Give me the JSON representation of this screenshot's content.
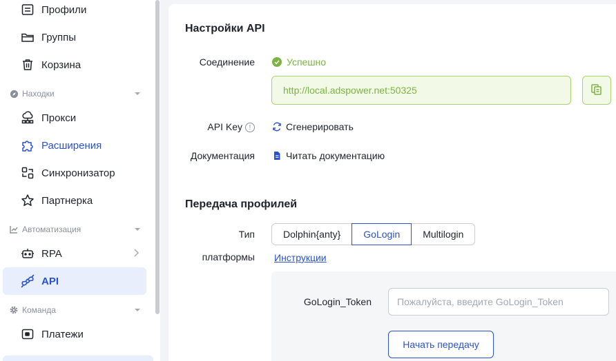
{
  "sidebar": {
    "items": [
      {
        "label": "Профили",
        "icon": "profiles-icon"
      },
      {
        "label": "Группы",
        "icon": "folder-icon"
      },
      {
        "label": "Корзина",
        "icon": "trash-icon"
      },
      {
        "label": "Прокси",
        "icon": "proxy-icon"
      },
      {
        "label": "Расширения",
        "icon": "puzzle-icon"
      },
      {
        "label": "Синхронизатор",
        "icon": "sync-icon"
      },
      {
        "label": "Партнерка",
        "icon": "star-icon"
      },
      {
        "label": "RPA",
        "icon": "robot-icon"
      },
      {
        "label": "API",
        "icon": "plug-icon"
      },
      {
        "label": "Платежи",
        "icon": "wallet-icon"
      }
    ],
    "sections": [
      {
        "label": "Находки",
        "icon": "compass-icon"
      },
      {
        "label": "Автоматизация",
        "icon": "automation-icon"
      },
      {
        "label": "Команда",
        "icon": "gear-icon"
      }
    ],
    "active": "API"
  },
  "api_settings": {
    "title": "Настройки API",
    "connection_label": "Соединение",
    "connection_status": "Успешно",
    "url": "http://local.adspower.net:50325",
    "api_key_label": "API Key",
    "generate_label": "Сгенерировать",
    "docs_label": "Документация",
    "docs_link": "Читать документацию"
  },
  "transfer": {
    "title": "Передача профилей",
    "platform_label_line1": "Тип",
    "platform_label_line2": "платформы",
    "platforms": [
      "Dolphin{anty}",
      "GoLogin",
      "Multilogin"
    ],
    "selected_platform": "GoLogin",
    "instructions_link": "Инструкции",
    "token_label": "GoLogin_Token",
    "token_placeholder": "Пожалуйста, введите GoLogin_Token",
    "token_value": "",
    "start_button": "Начать передачу"
  },
  "colors": {
    "accent": "#2a52c9",
    "success": "#7cb342"
  }
}
